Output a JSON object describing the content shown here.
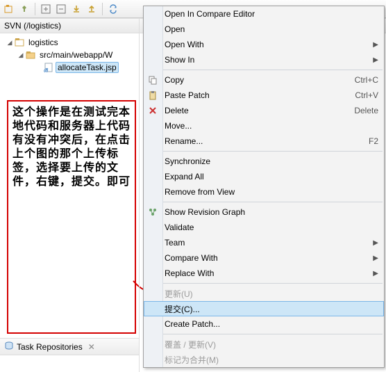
{
  "section_header": "SVN (/logistics)",
  "tree": {
    "node0": "logistics",
    "node1": "src/main/webapp/W",
    "node2": "allocateTask.jsp"
  },
  "note_text": "这个操作是在测试完本地代码和服务器上代码有没有冲突后，在点击上个图的那个上传标签，选择要上传的文件，右键，提交。即可",
  "task_repos": "Task Repositories",
  "menu": {
    "open_compare": "Open In Compare Editor",
    "open": "Open",
    "open_with": "Open With",
    "show_in": "Show In",
    "copy": "Copy",
    "copy_k": "Ctrl+C",
    "paste_patch": "Paste Patch",
    "paste_k": "Ctrl+V",
    "delete": "Delete",
    "delete_k": "Delete",
    "move": "Move...",
    "rename": "Rename...",
    "rename_k": "F2",
    "synchronize": "Synchronize",
    "expand_all": "Expand All",
    "remove_view": "Remove from View",
    "show_rev": "Show Revision Graph",
    "validate": "Validate",
    "team": "Team",
    "compare_with": "Compare With",
    "replace_with": "Replace With",
    "update": "更新(U)",
    "commit": "提交(C)...",
    "create_patch": "Create Patch...",
    "override": "覆盖 / 更新(V)",
    "mark_merged": "标记为合并(M)"
  }
}
